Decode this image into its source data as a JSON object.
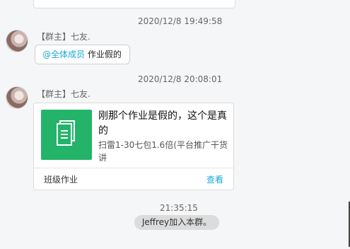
{
  "messages": {
    "ts1": "2020/12/8 19:49:58",
    "msg1": {
      "sender": "【群主】七友.",
      "mention": "@全体成员",
      "text": "作业假的"
    },
    "ts2": "2020/12/8 20:08:01",
    "msg2": {
      "sender": "【群主】七友.",
      "card": {
        "title": "刚那个作业是假的，这个是真的",
        "desc": "扫雷1-30七包1.6倍(平台推广干货讲",
        "footer_label": "班级作业",
        "view_label": "查看",
        "icon": "document-icon"
      }
    },
    "ts3": "21:35:15",
    "system_notice": "Jeffrey加入本群。"
  },
  "colors": {
    "accent": "#1aa9d8",
    "card_icon_bg": "#23b46a"
  }
}
